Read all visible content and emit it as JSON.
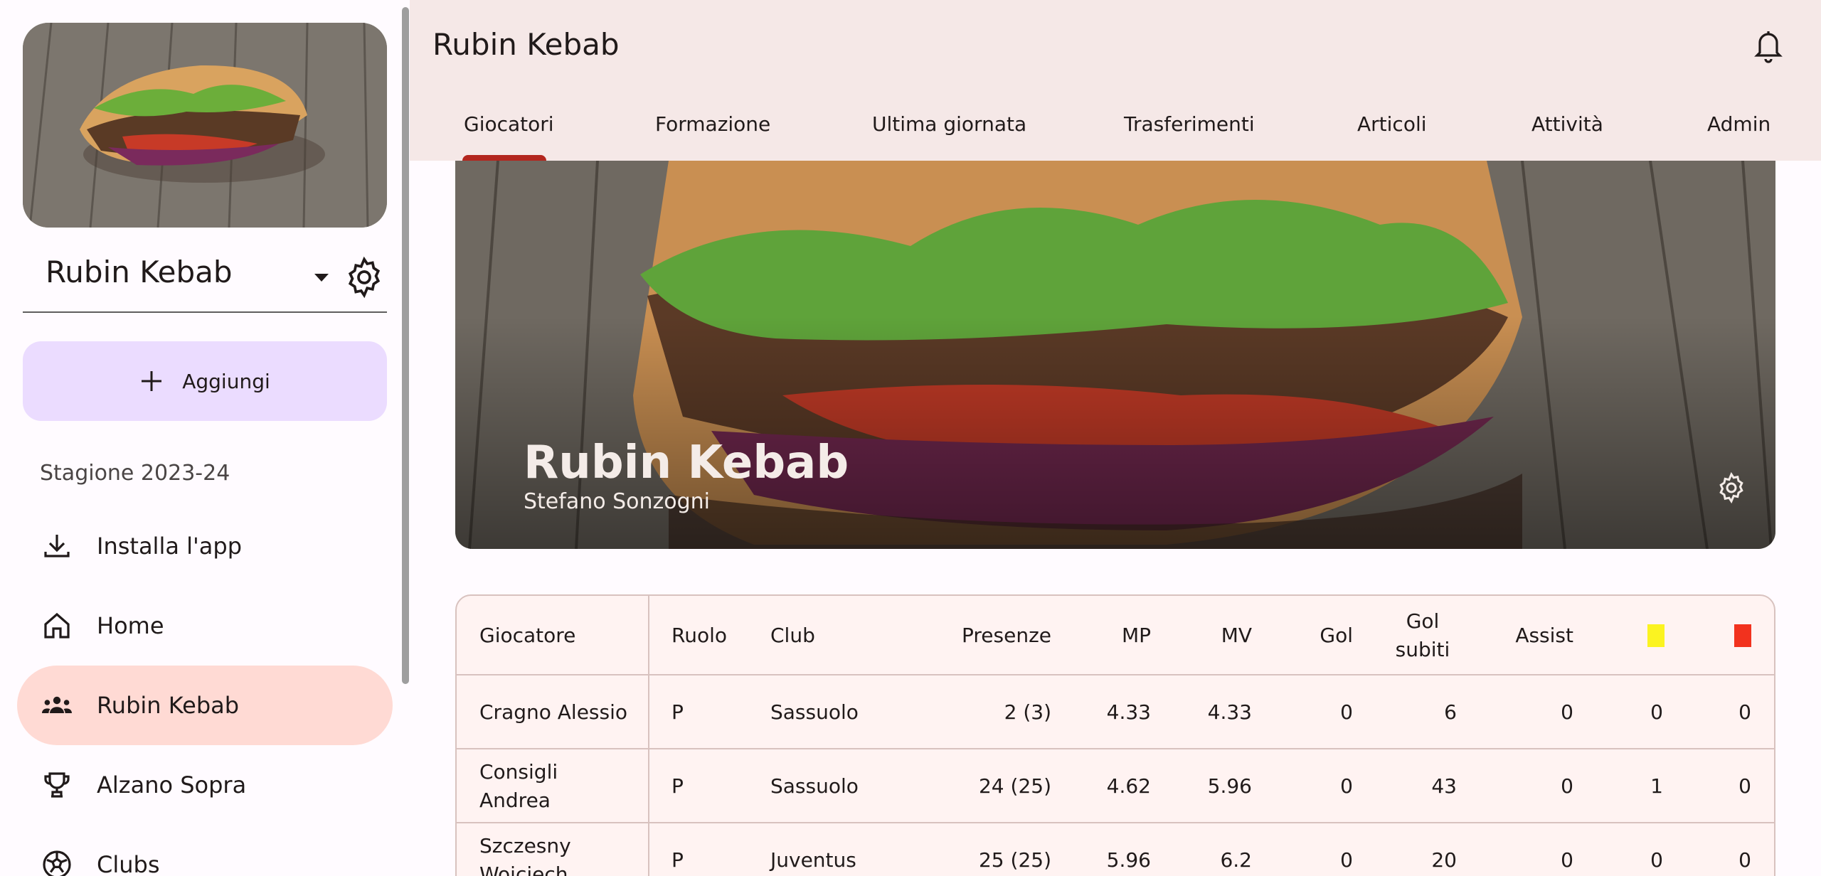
{
  "sidebar": {
    "league_name": "Rubin Kebab",
    "add_label": "Aggiungi",
    "season": "Stagione 2023-24",
    "items": [
      {
        "label": "Installa l'app",
        "icon": "download-icon"
      },
      {
        "label": "Home",
        "icon": "home-icon"
      },
      {
        "label": "Rubin Kebab",
        "icon": "team-icon",
        "active": true
      },
      {
        "label": "Alzano Sopra",
        "icon": "trophy-icon"
      },
      {
        "label": "Clubs",
        "icon": "soccer-ball-icon"
      }
    ]
  },
  "header": {
    "title": "Rubin Kebab",
    "tabs": [
      "Giocatori",
      "Formazione",
      "Ultima giornata",
      "Trasferimenti",
      "Articoli",
      "Attività",
      "Admin"
    ],
    "active_tab": "Giocatori"
  },
  "banner": {
    "title": "Rubin Kebab",
    "subtitle": "Stefano Sonzogni"
  },
  "table": {
    "columns": [
      "Giocatore",
      "Ruolo",
      "Club",
      "Presenze",
      "MP",
      "MV",
      "Gol",
      "Gol subiti",
      "Assist",
      "yellow-card-icon",
      "red-card-icon"
    ],
    "col_gol_subiti_1": "Gol",
    "col_gol_subiti_2": "subiti",
    "rows": [
      {
        "player": "Cragno Alessio",
        "player_1": "Cragno Alessio",
        "player_2": "",
        "role": "P",
        "club": "Sassuolo",
        "presenze": "2 (3)",
        "mp": "4.33",
        "mv": "4.33",
        "gol": "0",
        "gol_subiti": "6",
        "assist": "0",
        "yellow": "0",
        "red": "0"
      },
      {
        "player": "Consigli Andrea",
        "player_1": "Consigli",
        "player_2": "Andrea",
        "role": "P",
        "club": "Sassuolo",
        "presenze": "24 (25)",
        "mp": "4.62",
        "mv": "5.96",
        "gol": "0",
        "gol_subiti": "43",
        "assist": "0",
        "yellow": "1",
        "red": "0"
      },
      {
        "player": "Szczesny Wojciech",
        "player_1": "Szczesny",
        "player_2": "Wojciech",
        "role": "P",
        "club": "Juventus",
        "presenze": "25 (25)",
        "mp": "5.96",
        "mv": "6.2",
        "gol": "0",
        "gol_subiti": "20",
        "assist": "0",
        "yellow": "0",
        "red": "0"
      }
    ]
  },
  "colors": {
    "accent": "#b3261e",
    "topbar_bg": "#f5e8e7",
    "active_nav_bg": "#ffdad4",
    "add_button_bg": "#ebdcff",
    "yellow_card": "#fbf321",
    "red_card": "#f2321e"
  }
}
